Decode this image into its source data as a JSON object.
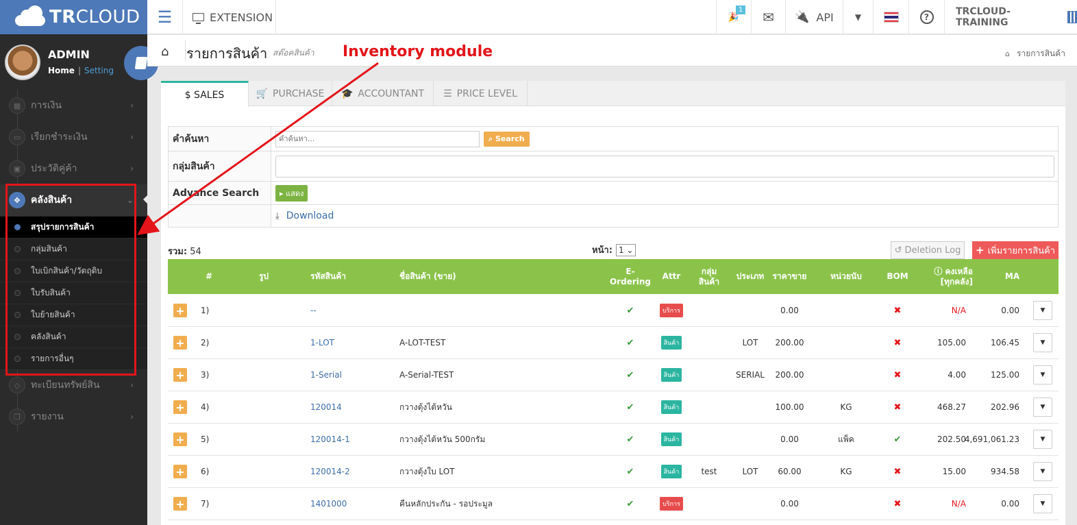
{
  "app": {
    "logo_bold": "TR",
    "logo_rest": "CLOUD"
  },
  "topbar": {
    "extension_label": "EXTENSION",
    "notif_count": "1",
    "api_label": "API",
    "company": "TRCLOUD-TRAINING"
  },
  "profile": {
    "name": "ADMIN",
    "home": "Home",
    "sep": "|",
    "setting": "Setting"
  },
  "sidebar": {
    "items": [
      {
        "label": "การเงิน"
      },
      {
        "label": "เรียกชำระเงิน"
      },
      {
        "label": "ประวัติคู่ค้า"
      },
      {
        "label": "คลังสินค้า"
      },
      {
        "label": "ทะเบียนทรัพย์สิน"
      },
      {
        "label": "รายงาน"
      }
    ],
    "sub_items": [
      {
        "label": "สรุปรายการสินค้า"
      },
      {
        "label": "กลุ่มสินค้า"
      },
      {
        "label": "ใบเบิกสินค้า/วัตถุดิบ"
      },
      {
        "label": "ใบรับสินค้า"
      },
      {
        "label": "ใบย้ายสินค้า"
      },
      {
        "label": "คลังสินค้า"
      },
      {
        "label": "รายการอื่นๆ"
      }
    ]
  },
  "page": {
    "title": "รายการสินค้า",
    "subtitle": "สต๊อคสินค้า",
    "annotation": "Inventory module",
    "breadcrumb": "รายการสินค้า"
  },
  "tabs": [
    {
      "label": "$ SALES"
    },
    {
      "label": "PURCHASE"
    },
    {
      "label": "ACCOUNTANT"
    },
    {
      "label": "PRICE LEVEL"
    }
  ],
  "search": {
    "label": "คำค้นหา",
    "placeholder": "คำค้นหา...",
    "button": "Search",
    "group_label": "กลุ่มสินค้า",
    "advance_label": "Advance Search",
    "show_button": "แสดง",
    "download": "Download"
  },
  "list": {
    "total_label": "รวม:",
    "total_value": "54",
    "page_label": "หน้า:",
    "page_value": "1",
    "deletion_log": "Deletion Log",
    "add_button": "เพิ่มรายการสินค้า"
  },
  "columns": {
    "num": "#",
    "img": "รูป",
    "code": "รหัสสินค้า",
    "name": "ชื่อสินค้า (ขาย)",
    "eorder_1": "E-",
    "eorder_2": "Ordering",
    "attr": "Attr",
    "group_1": "กลุ่ม",
    "group_2": "สินค้า",
    "type": "ประเภท",
    "price": "ราคาขาย",
    "unit": "หน่วยนับ",
    "bom": "BOM",
    "stock_1": "คงเหลือ",
    "stock_2": "[ทุกคลัง]",
    "ma": "MA"
  },
  "rows": [
    {
      "num": "1)",
      "code": "--",
      "name": "",
      "eorder": "✔",
      "attr": "บริการ",
      "attr_kind": "svc",
      "group": "",
      "type": "",
      "price": "0.00",
      "unit": "",
      "bom": "✖",
      "stock": "N/A",
      "ma": "0.00"
    },
    {
      "num": "2)",
      "code": "1-LOT",
      "name": "A-LOT-TEST",
      "eorder": "✔",
      "attr": "สินค้า",
      "attr_kind": "prd",
      "group": "",
      "type": "LOT",
      "price": "200.00",
      "unit": "",
      "bom": "✖",
      "stock": "105.00",
      "ma": "106.45"
    },
    {
      "num": "3)",
      "code": "1-Serial",
      "name": "A-Serial-TEST",
      "eorder": "✔",
      "attr": "สินค้า",
      "attr_kind": "prd",
      "group": "",
      "type": "SERIAL",
      "price": "200.00",
      "unit": "",
      "bom": "✖",
      "stock": "4.00",
      "ma": "125.00"
    },
    {
      "num": "4)",
      "code": "120014",
      "name": "กวางตุ้งไต้หวัน",
      "eorder": "✔",
      "attr": "สินค้า",
      "attr_kind": "prd",
      "group": "",
      "type": "",
      "price": "100.00",
      "unit": "KG",
      "bom": "✖",
      "stock": "468.27",
      "ma": "202.96"
    },
    {
      "num": "5)",
      "code": "120014-1",
      "name": "กวางตุ้งไต้หวัน 500กรัม",
      "eorder": "✔",
      "attr": "สินค้า",
      "attr_kind": "prd",
      "group": "",
      "type": "",
      "price": "0.00",
      "unit": "แพ็ค",
      "bom": "✔",
      "stock": "202.50",
      "ma": "4,691,061.23"
    },
    {
      "num": "6)",
      "code": "120014-2",
      "name": "กวางตุ้งใบ LOT",
      "eorder": "✔",
      "attr": "สินค้า",
      "attr_kind": "prd",
      "group": "test",
      "type": "LOT",
      "price": "60.00",
      "unit": "KG",
      "bom": "✖",
      "stock": "15.00",
      "ma": "934.58"
    },
    {
      "num": "7)",
      "code": "1401000",
      "name": "คืนหลักประกัน - รอประมูล",
      "eorder": "✔",
      "attr": "บริการ",
      "attr_kind": "svc",
      "group": "",
      "type": "",
      "price": "0.00",
      "unit": "",
      "bom": "✖",
      "stock": "N/A",
      "ma": "0.00"
    }
  ],
  "colors": {
    "brand": "#4e79b8",
    "header_green": "#8bc34a",
    "annotation_red": "#e3151a",
    "add_red": "#ee5a5a",
    "search_orange": "#f0ad4e"
  }
}
